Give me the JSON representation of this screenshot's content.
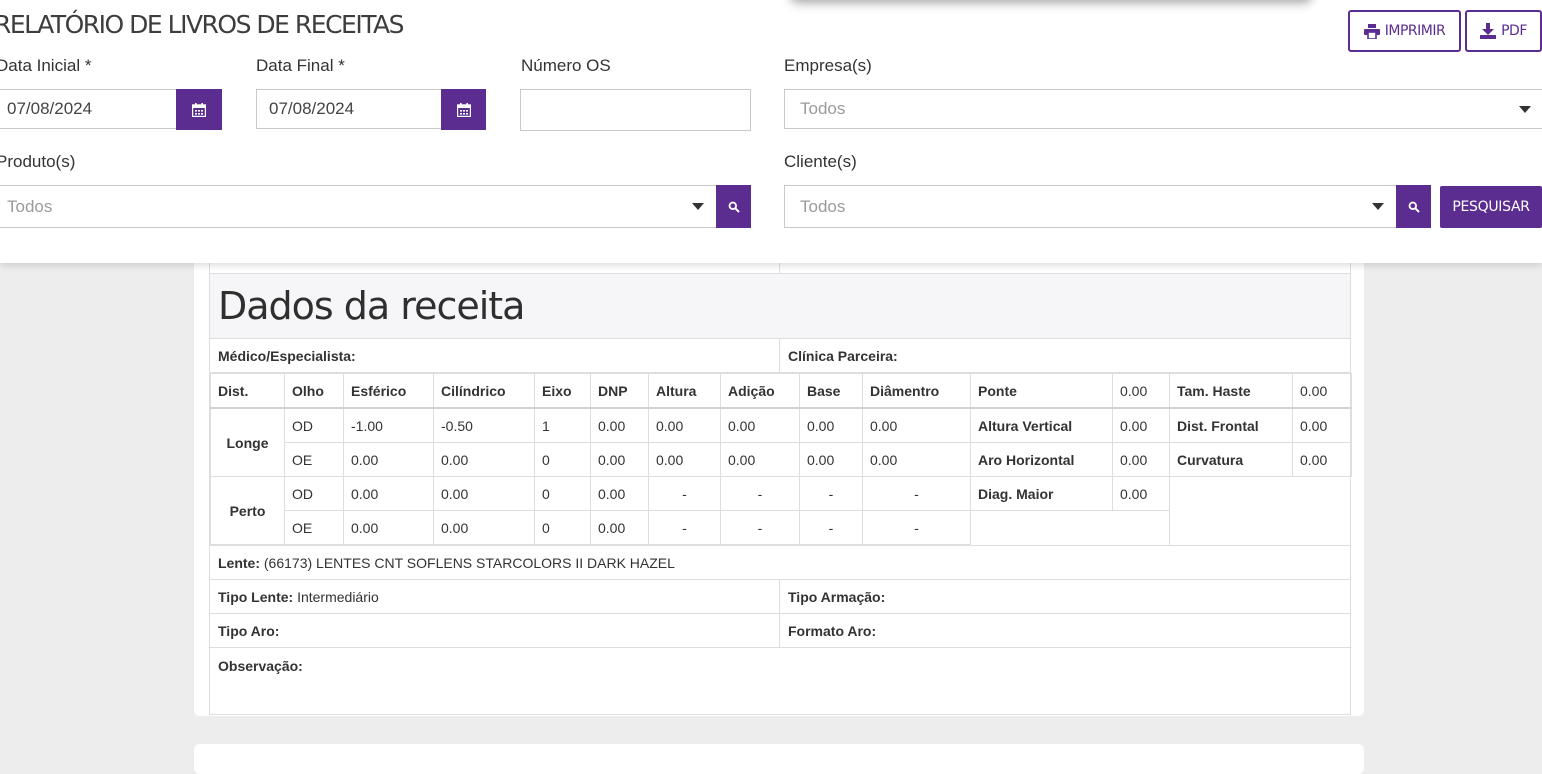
{
  "header": {
    "title": "RELATÓRIO DE LIVROS DE RECEITAS",
    "print_label": "IMPRIMIR",
    "pdf_label": "PDF"
  },
  "filters": {
    "data_inicial": {
      "label": "Data Inicial *",
      "value": "07/08/2024"
    },
    "data_final": {
      "label": "Data Final *",
      "value": "07/08/2024"
    },
    "numero_os": {
      "label": "Número OS",
      "value": ""
    },
    "empresas": {
      "label": "Empresa(s)",
      "value": "Todos"
    },
    "produtos": {
      "label": "Produto(s)",
      "value": "Todos"
    },
    "clientes": {
      "label": "Cliente(s)",
      "value": "Todos"
    },
    "search_label": "PESQUISAR"
  },
  "report": {
    "section_title": "Dados da receita",
    "medico_label": "Médico/Especialista:",
    "medico_value": "",
    "clinica_label": "Clínica Parceira:",
    "clinica_value": "",
    "grid": {
      "headers": [
        "Dist.",
        "Olho",
        "Esférico",
        "Cilíndrico",
        "Eixo",
        "DNP",
        "Altura",
        "Adição",
        "Base",
        "Diâmentro"
      ],
      "longe_label": "Longe",
      "perto_label": "Perto",
      "rows": [
        [
          "OD",
          "-1.00",
          "-0.50",
          "1",
          "0.00",
          "0.00",
          "0.00",
          "0.00",
          "0.00"
        ],
        [
          "OE",
          "0.00",
          "0.00",
          "0",
          "0.00",
          "0.00",
          "0.00",
          "0.00",
          "0.00"
        ],
        [
          "OD",
          "0.00",
          "0.00",
          "0",
          "0.00",
          "-",
          "-",
          "-",
          "-"
        ],
        [
          "OE",
          "0.00",
          "0.00",
          "0",
          "0.00",
          "-",
          "-",
          "-",
          "-"
        ]
      ],
      "measures": [
        {
          "label": "Ponte",
          "value": "0.00",
          "label2": "Tam. Haste",
          "value2": "0.00"
        },
        {
          "label": "Altura Vertical",
          "value": "0.00",
          "label2": "Dist. Frontal",
          "value2": "0.00"
        },
        {
          "label": "Aro Horizontal",
          "value": "0.00",
          "label2": "Curvatura",
          "value2": "0.00"
        },
        {
          "label": "Diag. Maior",
          "value": "0.00"
        }
      ]
    },
    "lente_label": "Lente:",
    "lente_value": "(66173) LENTES CNT SOFLENS STARCOLORS II DARK HAZEL",
    "tipo_lente_label": "Tipo Lente:",
    "tipo_lente_value": "Intermediário",
    "tipo_armacao_label": "Tipo Armação:",
    "tipo_armacao_value": "",
    "tipo_aro_label": "Tipo Aro:",
    "tipo_aro_value": "",
    "formato_aro_label": "Formato Aro:",
    "formato_aro_value": "",
    "observacao_label": "Observação:",
    "observacao_value": ""
  },
  "colors": {
    "accent": "#5c2d91",
    "page_background": "#ededed",
    "border": "#dedede"
  },
  "icons": [
    "print-icon",
    "download-icon",
    "calendar-icon",
    "search-icon",
    "chevron-down-icon"
  ]
}
